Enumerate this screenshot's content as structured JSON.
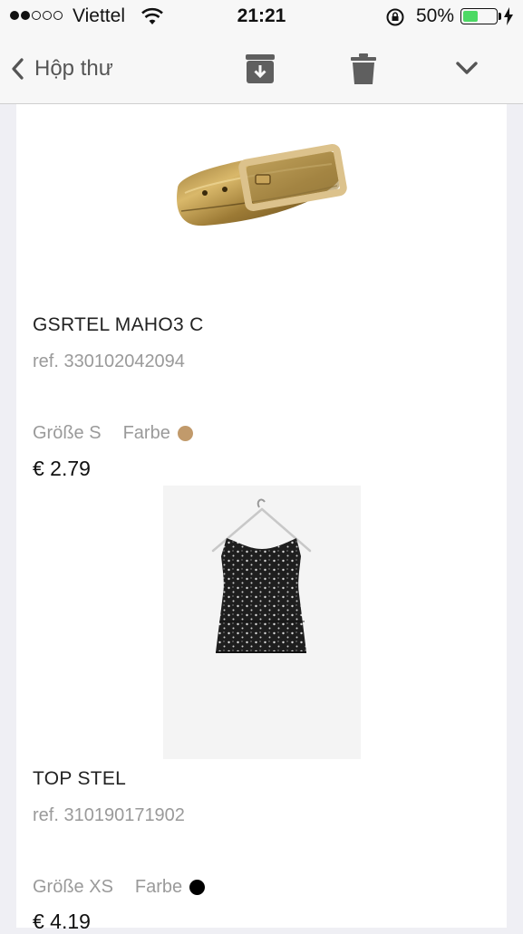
{
  "status_bar": {
    "carrier": "Viettel",
    "time": "21:21",
    "battery_percent": "50%",
    "battery_level": 0.5,
    "battery_color": "#4cd964"
  },
  "nav": {
    "back_label": "Hộp thư",
    "icons": [
      "chevron-left-icon",
      "archive-icon",
      "trash-icon",
      "chevron-down-icon"
    ]
  },
  "products": [
    {
      "name": "GSRTEL MAHO3 C",
      "ref": "ref. 330102042094",
      "size": "Größe S",
      "color_label": "Farbe",
      "color_hex": "#c19a6b",
      "price": "€ 2.79",
      "image": "gold-belt-image"
    },
    {
      "name": "TOP STEL",
      "ref": "ref. 310190171902",
      "size": "Größe XS",
      "color_label": "Farbe",
      "color_hex": "#000000",
      "price": "€ 4.19",
      "image": "black-top-image"
    }
  ]
}
